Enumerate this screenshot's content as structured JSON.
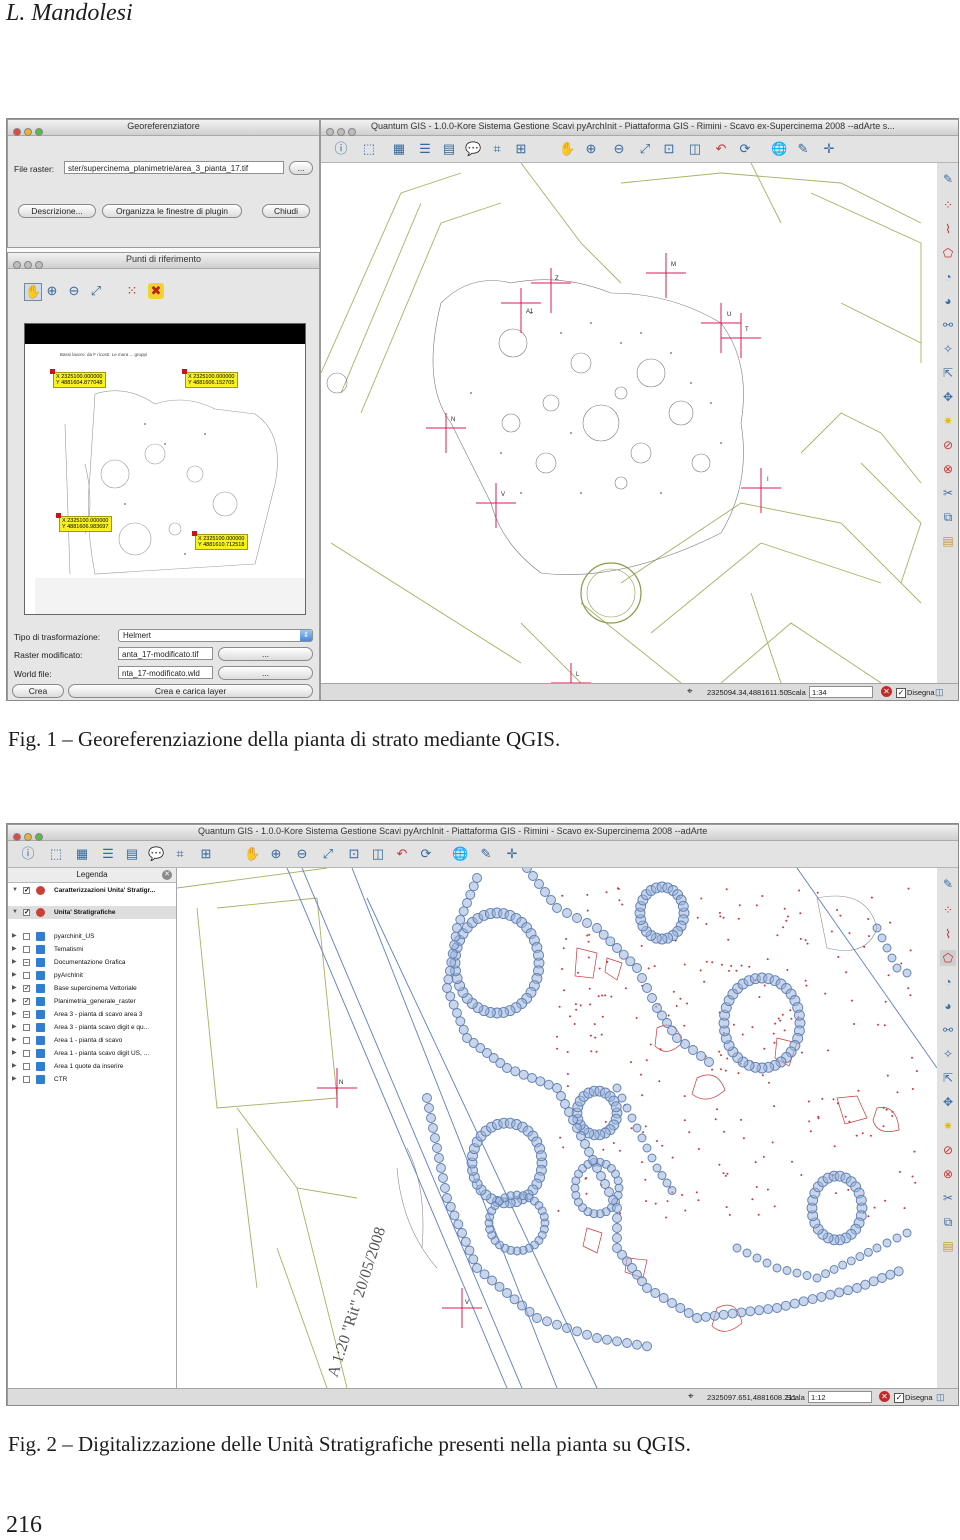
{
  "page": {
    "running_head": "L. Mandolesi",
    "page_number": "216"
  },
  "figure1": {
    "caption": "Fig. 1 – Georeferenziazione della pianta di strato mediante QGIS.",
    "georef_window": {
      "title": "Georeferenziatore",
      "file_raster_label": "File raster:",
      "file_raster_value": "ster/supercinema_planimetrie/area_3_pianta_17.tif",
      "browse_label": "...",
      "description_button": "Descrizione...",
      "organize_button": "Organizza le finestre di plugin",
      "close_button": "Chiudi"
    },
    "points_window": {
      "title": "Punti di riferimento",
      "transform_label": "Tipo di trasformazione:",
      "transform_value": "Helmert",
      "raster_mod_label": "Raster modificato:",
      "raster_mod_value": "anta_17-modificato.tif",
      "world_file_label": "World file:",
      "world_file_value": "nta_17-modificato.wld",
      "browse_label": "...",
      "create_button": "Crea",
      "create_load_button": "Crea e carica layer",
      "preview_title": "Bassi lavoro: da F ricostr. Le mura ... gruppi",
      "points": [
        {
          "x": "X 2325100.000000",
          "y": "Y 4881604.877048"
        },
        {
          "x": "X 2325100.000000",
          "y": "Y 4881606.152705"
        },
        {
          "x": "X 2325100.000000",
          "y": "Y 4881606.983697"
        },
        {
          "x": "X 2325100.000000",
          "y": "Y 4881610.712518"
        }
      ]
    },
    "qgis_window": {
      "title": "Quantum GIS - 1.0.0-Kore Sistema Gestione Scavi pyArchInit - Piattaforma GIS - Rimini - Scavo ex-Supercinema 2008 --adArte s...",
      "point_labels": [
        "A1",
        "Z",
        "M",
        "U",
        "T",
        "N",
        "V",
        "I",
        "L"
      ],
      "status_coords": "2325094.34,4881611.50",
      "scale_label": "Scala",
      "scale_value": "1:34",
      "render_label": "Disegna"
    }
  },
  "figure2": {
    "caption": "Fig. 2 – Digitalizzazione delle Unità Stratigrafiche presenti nella pianta su QGIS.",
    "qgis_window": {
      "title": "Quantum GIS - 1.0.0-Kore Sistema Gestione Scavi pyArchInit - Piattaforma GIS - Rimini - Scavo ex-Supercinema 2008 --adArte",
      "legend_title": "Legenda",
      "layers": [
        {
          "name": "Caratterizzazioni Unita' Stratigr...",
          "group": true,
          "checked": true
        },
        {
          "name": "Unita' Stratigrafiche",
          "group": true,
          "checked": true,
          "selected": true
        },
        {
          "name": "pyarchinit_US",
          "checked": false
        },
        {
          "name": "Tematismi",
          "checked": false
        },
        {
          "name": "Documentazione Grafica",
          "checked": true
        },
        {
          "name": "pyArchInit",
          "checked": false
        },
        {
          "name": "Base supercinema Vettoriale",
          "checked": true
        },
        {
          "name": "Planimetria_generale_raster",
          "checked": true
        },
        {
          "name": "Area 3 - pianta di scavo area 3",
          "checked": false
        },
        {
          "name": "Area 3 - pianta scavo digit e qu...",
          "checked": false
        },
        {
          "name": "Area 1 - pianta di scavo",
          "checked": false
        },
        {
          "name": "Area 1 - pianta scavo digit US, ...",
          "checked": false
        },
        {
          "name": "Area 1 quote da inserire",
          "checked": false
        },
        {
          "name": "CTR",
          "checked": false
        }
      ],
      "map_annotations": [
        "N",
        "V",
        "A 1:20 \"Rit\" 20/05/2008"
      ],
      "status_coords": "2325097.651,4881608.211",
      "scale_label": "Scala",
      "scale_value": "1:12",
      "render_label": "Disegna"
    }
  },
  "colors": {
    "us_circles": "#6d91c4",
    "us_red": "#d2343a",
    "plan_lines": "#a8b060",
    "crosshair": "#d81b53",
    "title_bar": "#d7d7d7"
  }
}
